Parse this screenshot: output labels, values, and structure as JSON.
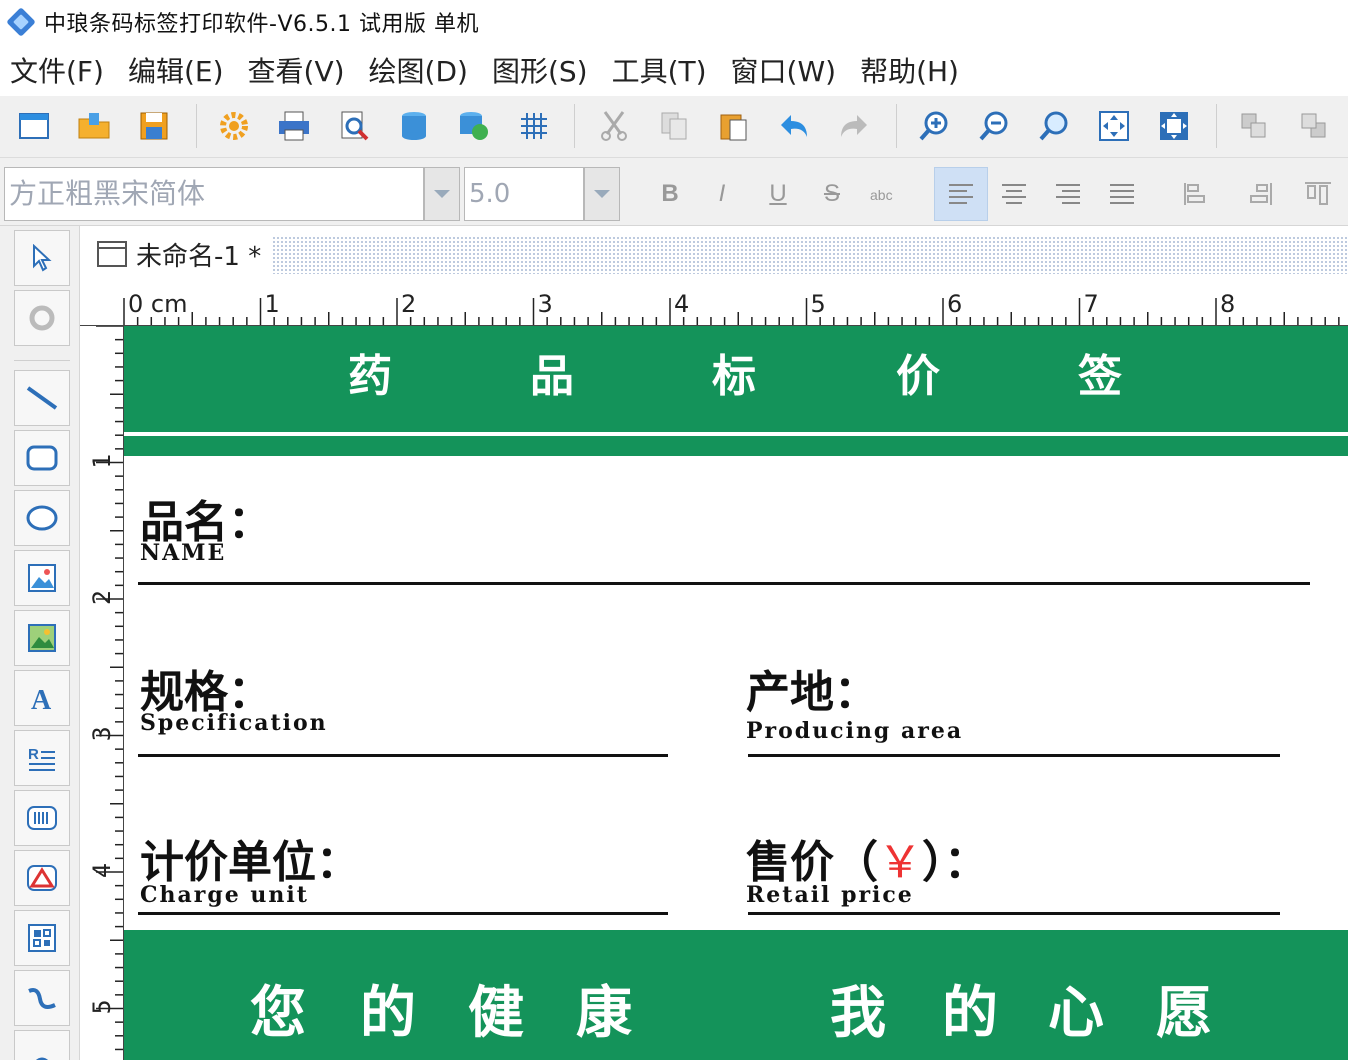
{
  "window": {
    "title": "中琅条码标签打印软件-V6.5.1 试用版 单机"
  },
  "menu": [
    "文件(F)",
    "编辑(E)",
    "查看(V)",
    "绘图(D)",
    "图形(S)",
    "工具(T)",
    "窗口(W)",
    "帮助(H)"
  ],
  "toolbar": {
    "icons": [
      "new-icon",
      "open-icon",
      "save-icon",
      "settings-icon",
      "print-icon",
      "print-preview-icon",
      "database-icon",
      "database-connect-icon",
      "grid-icon",
      "cut-icon",
      "copy-icon",
      "paste-icon",
      "undo-icon",
      "redo-icon",
      "zoom-in-icon",
      "zoom-out-icon",
      "zoom-icon",
      "fit-page-icon",
      "fit-selection-icon",
      "bring-front-icon",
      "send-back-icon"
    ]
  },
  "formatbar": {
    "font": "方正粗黑宋简体",
    "size": "5.0",
    "bold": "B",
    "italic": "I",
    "underline": "U",
    "strike": "S"
  },
  "document": {
    "tab_title": "未命名-1 *"
  },
  "ruler": {
    "top_labels": [
      "0 cm",
      "1",
      "2",
      "3",
      "4",
      "5",
      "6",
      "7",
      "8"
    ],
    "left_labels": [
      "1",
      "2",
      "3",
      "4",
      "5"
    ]
  },
  "label": {
    "header": [
      "药",
      "品",
      "标",
      "价",
      "签"
    ],
    "name_cn": "品名：",
    "name_en": "NAME",
    "spec_cn": "规格：",
    "spec_en": "Specification",
    "origin_cn": "产地：",
    "origin_en": "Producing area",
    "unit_cn": "计价单位：",
    "unit_en": "Charge unit",
    "price_cn_a": "售价（",
    "price_yen": "￥",
    "price_cn_b": "）：",
    "price_en": "Retail price",
    "footer": [
      "您",
      "的",
      "健",
      "康",
      "我",
      "的",
      "心",
      "愿"
    ]
  },
  "colors": {
    "brand_green": "#14935a",
    "accent_red": "#e33333"
  }
}
